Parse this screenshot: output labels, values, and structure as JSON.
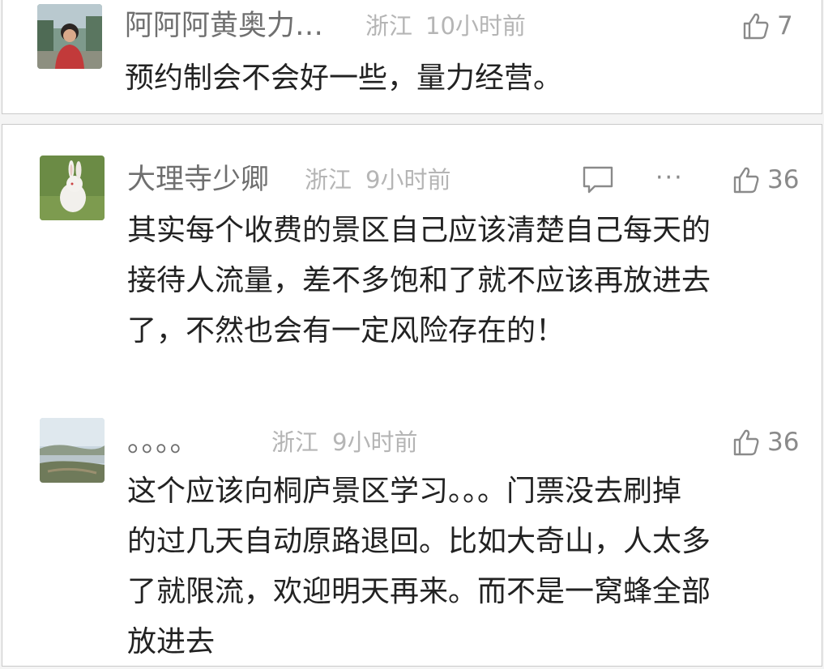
{
  "comments": [
    {
      "author": "阿阿阿黄奥力…",
      "location": "浙江",
      "time": "10小时前",
      "likes": "7",
      "avatar": "person-photo",
      "lines": [
        "预约制会不会好一些，量力经营。"
      ]
    },
    {
      "author": "大理寺少卿",
      "location": "浙江",
      "time": "9小时前",
      "likes": "36",
      "avatar": "white-rabbit-photo",
      "more": "···",
      "lines": [
        "其实每个收费的景区自己应该清楚自己每天的",
        "接待人流量，差不多饱和了就不应该再放进去",
        "了，不然也会有一定风险存在的！"
      ]
    },
    {
      "author": "。。。。",
      "location": "浙江",
      "time": "9小时前",
      "likes": "36",
      "avatar": "landscape-photo",
      "lines": [
        "这个应该向桐庐景区学习。。。门票没去刷掉",
        "的过几天自动原路退回。比如大奇山，人太多",
        "了就限流，欢迎明天再来。而不是一窝蜂全部",
        "放进去"
      ]
    }
  ]
}
